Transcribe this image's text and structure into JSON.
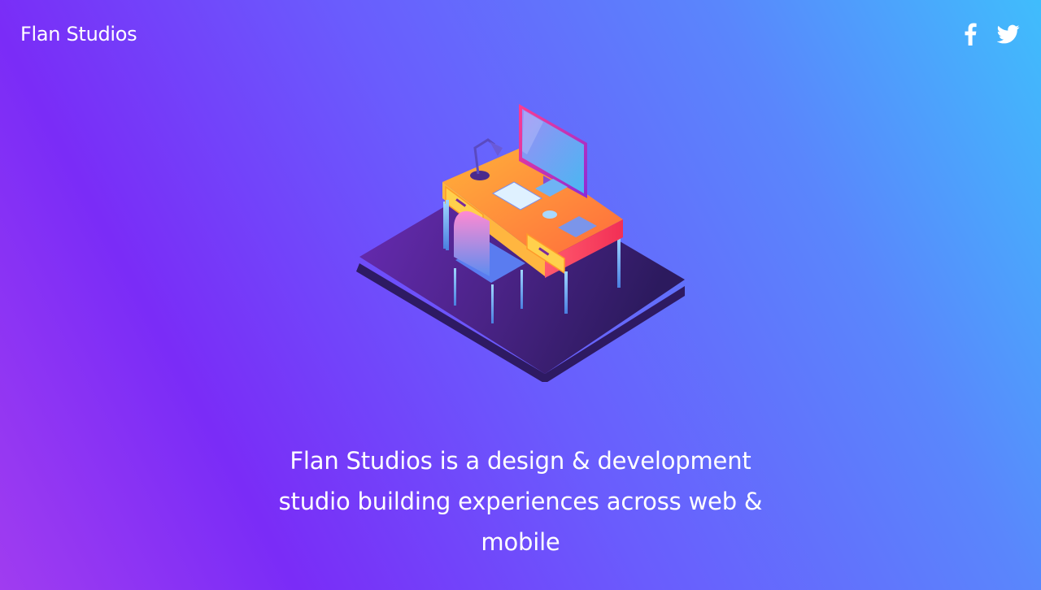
{
  "header": {
    "brand": "Flan Studios",
    "social": [
      {
        "name": "facebook",
        "icon": "facebook-icon"
      },
      {
        "name": "twitter",
        "icon": "twitter-icon"
      }
    ]
  },
  "hero": {
    "illustration": "isometric-desk-workspace-illustration"
  },
  "main": {
    "tagline": "Flan Studios is a design & development studio building experiences across web & mobile"
  },
  "colors": {
    "background_start": "#a03cf0",
    "background_mid": "#6a5cfd",
    "background_end": "#40bdfc",
    "desk_orange": "#ffa32b",
    "desk_pink": "#f5357a",
    "text": "#ffffff"
  }
}
